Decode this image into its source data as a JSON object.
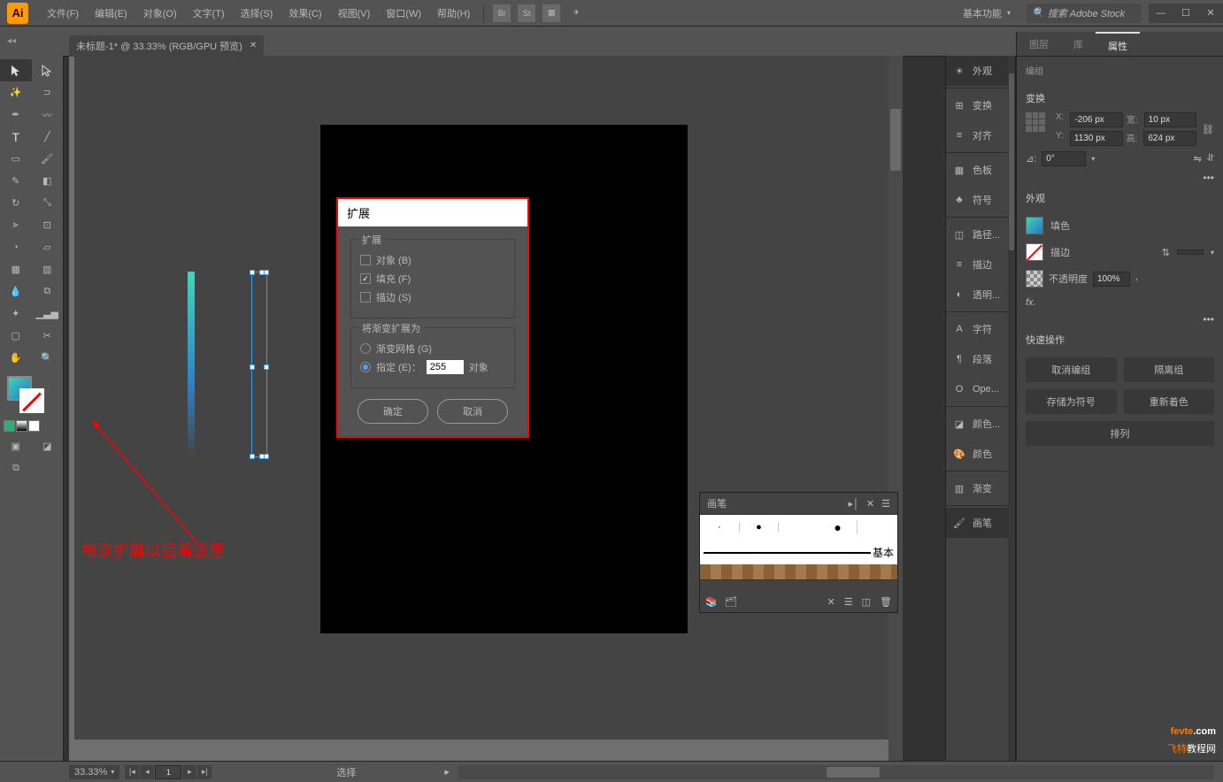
{
  "menubar": {
    "items": [
      "文件(F)",
      "编辑(E)",
      "对象(O)",
      "文字(T)",
      "选择(S)",
      "效果(C)",
      "视图(V)",
      "窗口(W)",
      "帮助(H)"
    ],
    "workspace": "基本功能",
    "searchPlaceholder": "搜索 Adobe Stock"
  },
  "docTab": {
    "title": "未标题-1* @ 33.33% (RGB/GPU 预览)"
  },
  "dialog": {
    "title": "扩展",
    "section1": "扩展",
    "opt_object": "对象 (B)",
    "opt_fill": "填充 (F)",
    "opt_stroke": "描边 (S)",
    "section2": "将渐变扩展为",
    "opt_mesh": "渐变网格 (G)",
    "opt_specify": "指定 (E)：",
    "specify_value": "255",
    "specify_unit": "对象",
    "ok": "确定",
    "cancel": "取消"
  },
  "annotation": "每次扩展以后看这里",
  "brushPanel": {
    "title": "画笔",
    "basic": "基本"
  },
  "dockItems": [
    "外观",
    "变换",
    "对齐",
    "色板",
    "符号",
    "路径...",
    "描边",
    "透明...",
    "字符",
    "段落",
    "Ope...",
    "颜色...",
    "颜色",
    "渐变",
    "画笔"
  ],
  "propsPanel": {
    "tabs": [
      "图层",
      "库",
      "属性"
    ],
    "groupLabel": "编组",
    "transform": "变换",
    "x": "-206 px",
    "y": "1130 px",
    "w": "10 px",
    "h": "624 px",
    "rot": "0°",
    "appearance": "外观",
    "fill": "填色",
    "stroke": "描边",
    "opacity": "不透明度",
    "opacityVal": "100%",
    "quick": "快速操作",
    "btn_ungroup": "取消编组",
    "btn_isolate": "隔离组",
    "btn_saveSymbol": "存储为符号",
    "btn_recolor": "重新着色",
    "btn_arrange": "排列"
  },
  "statusbar": {
    "zoom": "33.33%",
    "page": "1",
    "tool": "选择"
  },
  "watermark": {
    "line1a": "fevte",
    "line1b": ".com",
    "line2a": "飞特",
    "line2b": "教程网"
  }
}
